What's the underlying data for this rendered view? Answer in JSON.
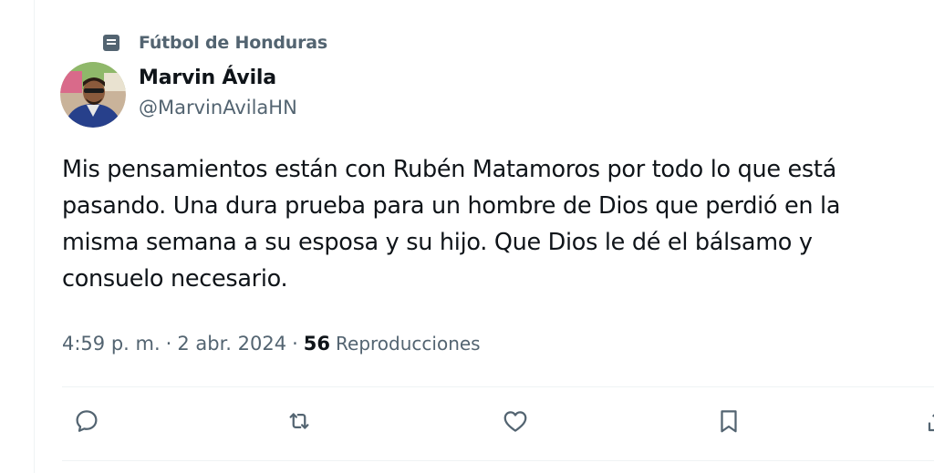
{
  "tweet": {
    "community_name": "Fútbol de Honduras",
    "author": {
      "display_name": "Marvin Ávila",
      "handle": "@MarvinAvilaHN"
    },
    "text": "Mis pensamientos están con Rubén Matamoros por todo lo que está\npasando. Una dura prueba para un hombre de Dios que perdió en la\nmisma semana a su esposa y su hijo. Que Dios le dé el bálsamo y\nconsuelo necesario.",
    "time": "4:59 p. m.",
    "separator": "·",
    "date": "2 abr. 2024",
    "views_count": "56",
    "views_label": "Reproducciones"
  },
  "actions": {
    "reply_icon": "reply-icon",
    "retweet_icon": "retweet-icon",
    "like_icon": "heart-icon",
    "bookmark_icon": "bookmark-icon",
    "share_icon": "share-icon"
  },
  "colors": {
    "text_primary": "#0f1419",
    "text_secondary": "#536471",
    "divider": "#eff3f4"
  }
}
